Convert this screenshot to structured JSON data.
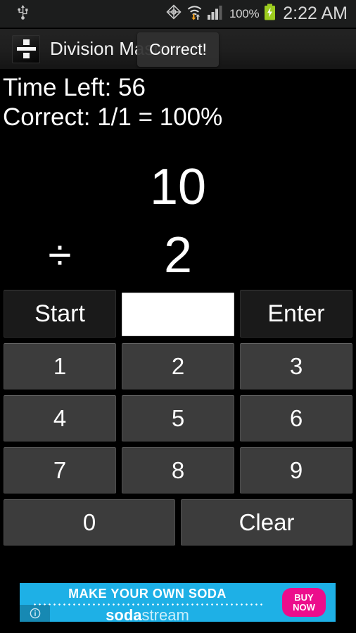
{
  "status_bar": {
    "usb_icon": "usb-icon",
    "gps_icon": "gps-crosshair-icon",
    "wifi_icon": "wifi-transfer-icon",
    "signal_icon": "signal-bars-icon",
    "battery_percent": "100%",
    "battery_icon": "battery-charging-icon",
    "time": "2:22 AM",
    "background": "#1c1d1d"
  },
  "title_bar": {
    "app_icon": "division-app-icon",
    "title": "Division Master"
  },
  "toast": {
    "message": "Correct!"
  },
  "stats": {
    "time_left": "Time Left: 56",
    "correct": "Correct: 1/1 = 100%"
  },
  "problem": {
    "dividend": "10",
    "operator": "÷",
    "divisor": "2"
  },
  "controls": {
    "start_label": "Start",
    "enter_label": "Enter",
    "answer_value": "",
    "answer_placeholder": ""
  },
  "keypad": {
    "rows": [
      [
        "1",
        "2",
        "3"
      ],
      [
        "4",
        "5",
        "6"
      ],
      [
        "7",
        "8",
        "9"
      ]
    ],
    "zero_label": "0",
    "clear_label": "Clear"
  },
  "ad": {
    "headline": "MAKE YOUR OWN SODA",
    "brand_bold": "soda",
    "brand_light": "stream",
    "cta_line1": "BUY",
    "cta_line2": "NOW",
    "info_icon": "info-icon",
    "bg_color": "#1eb0e6",
    "cta_color": "#ec0d8c"
  }
}
